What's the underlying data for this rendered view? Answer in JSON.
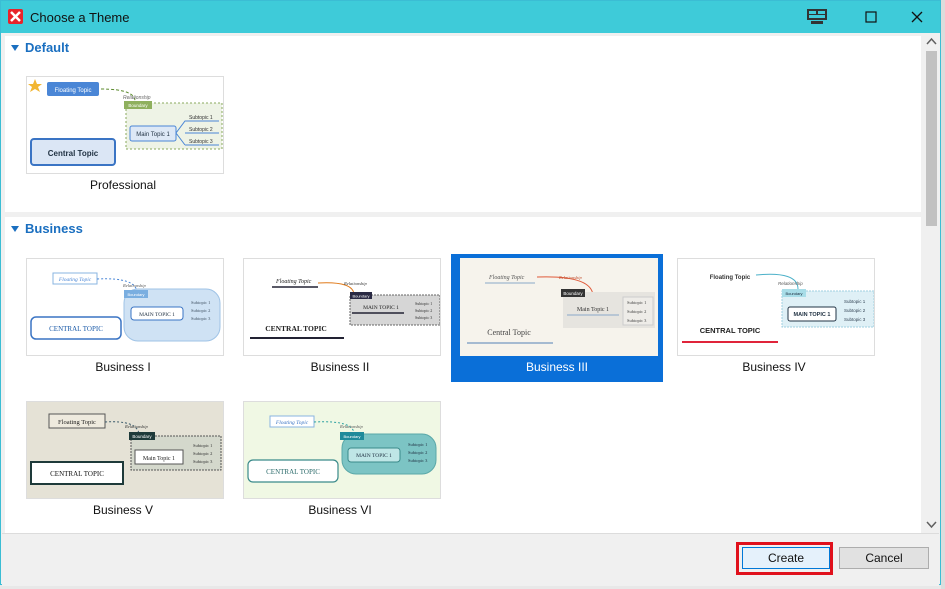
{
  "window": {
    "title": "Choose a Theme"
  },
  "sections": [
    {
      "header": "Default",
      "themes": [
        {
          "label": "Professional"
        }
      ]
    },
    {
      "header": "Business",
      "themes": [
        {
          "label": "Business I"
        },
        {
          "label": "Business II"
        },
        {
          "label": "Business III",
          "selected": true
        },
        {
          "label": "Business IV"
        },
        {
          "label": "Business V"
        },
        {
          "label": "Business VI"
        }
      ]
    }
  ],
  "thumb_text": {
    "floating": "Floating Topic",
    "relationship": "Relationship",
    "boundary": "Boundary",
    "main": "Main Topic 1",
    "main_upper": "MAIN TOPIC 1",
    "sub1": "Subtopic 1",
    "sub2": "Subtopic 2",
    "sub3": "Subtopic 3",
    "central": "Central Topic",
    "central_upper": "CENTRAL TOPIC"
  },
  "buttons": {
    "create": "Create",
    "cancel": "Cancel"
  },
  "colors": {
    "titlebar": "#3ecbd9",
    "accent": "#1a6fc0",
    "selected": "#0a6fd8",
    "highlight": "#e0101b"
  },
  "icons": {
    "app": "xmind-icon",
    "layout": "layout-icon"
  }
}
